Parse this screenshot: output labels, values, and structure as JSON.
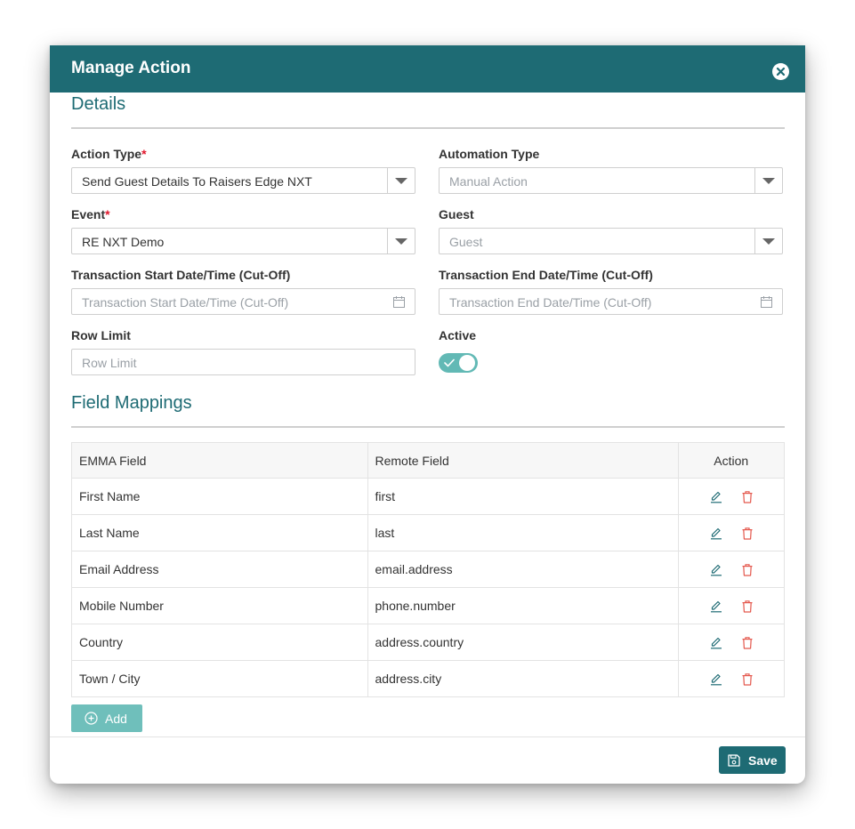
{
  "dialog": {
    "title": "Manage Action",
    "close_icon": "close-circle-icon"
  },
  "details": {
    "title": "Details",
    "action_type": {
      "label": "Action Type",
      "required": "*",
      "value": "Send Guest Details To Raisers Edge NXT"
    },
    "automation_type": {
      "label": "Automation Type",
      "placeholder": "Manual Action"
    },
    "event": {
      "label": "Event",
      "required": "*",
      "value": "RE NXT Demo"
    },
    "guest": {
      "label": "Guest",
      "placeholder": "Guest"
    },
    "transaction_start": {
      "label": "Transaction Start Date/Time (Cut-Off)",
      "placeholder": "Transaction Start Date/Time (Cut-Off)"
    },
    "transaction_end": {
      "label": "Transaction End Date/Time (Cut-Off)",
      "placeholder": "Transaction End Date/Time (Cut-Off)"
    },
    "row_limit": {
      "label": "Row Limit",
      "placeholder": "Row Limit"
    },
    "active": {
      "label": "Active",
      "checked": true
    }
  },
  "field_mappings": {
    "title": "Field Mappings",
    "columns": [
      "EMMA Field",
      "Remote Field",
      "Action"
    ],
    "rows": [
      {
        "emma": "First Name",
        "remote": "first"
      },
      {
        "emma": "Last Name",
        "remote": "last"
      },
      {
        "emma": "Email Address",
        "remote": "email.address"
      },
      {
        "emma": "Mobile Number",
        "remote": "phone.number"
      },
      {
        "emma": "Country",
        "remote": "address.country"
      },
      {
        "emma": "Town / City",
        "remote": "address.city"
      }
    ],
    "add_label": "Add"
  },
  "footer": {
    "save_label": "Save"
  },
  "colors": {
    "header": "#1e6b74",
    "accent": "#1e6b74",
    "required": "#e0162b",
    "toggle_on": "#62b9b5",
    "add_button": "#6fbfbb",
    "delete_icon": "#e4574c"
  }
}
